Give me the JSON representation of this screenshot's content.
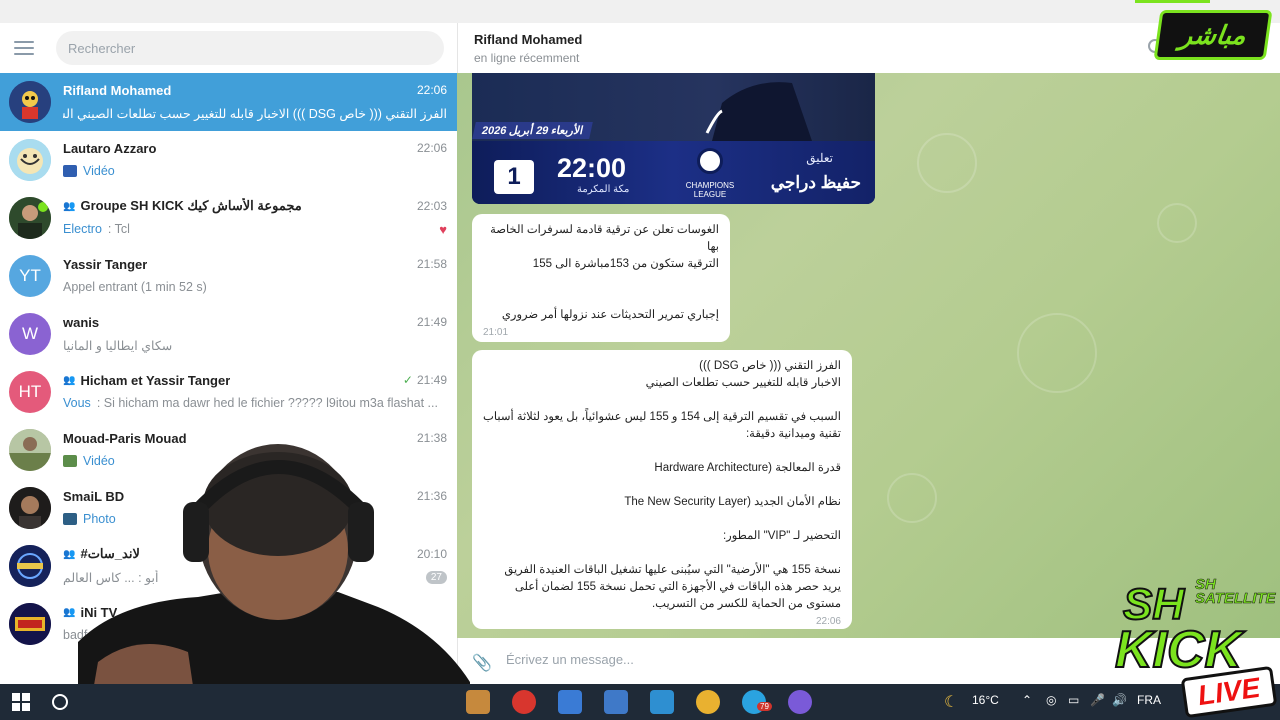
{
  "sidebar": {
    "search_placeholder": "Rechercher",
    "chats": [
      {
        "name": "Rifland Mohamed",
        "time": "22:06",
        "preview": "الفرز التقني ((( خاص DSG ))) الاخبار قابله للتغيير حسب تطلعات الصيني  السبب...",
        "avatar_color": "#2b4f9e",
        "active": true
      },
      {
        "name": "Lautaro Azzaro",
        "time": "22:06",
        "preview": "Vidéo",
        "avatar_color": "#7fc9e6"
      },
      {
        "name": "Groupe SH KICK مجموعة الأساش كيك",
        "time": "22:03",
        "preview_prefix": "Electro",
        "preview": ": Tcl",
        "avatar_color": "#3c6b3a"
      },
      {
        "name": "Yassir Tanger",
        "time": "21:58",
        "preview": "Appel entrant (1 min 52 s)",
        "avatar_text": "YT",
        "avatar_color": "#56a7e0"
      },
      {
        "name": "wanis",
        "time": "21:49",
        "preview": "سكاي ايطاليا و المانيا",
        "avatar_text": "W",
        "avatar_color": "#8a63d2"
      },
      {
        "name": "Hicham et Yassir Tanger",
        "time": "21:49",
        "preview_prefix": "Vous",
        "preview": ": Si hicham ma dawr hed le fichier ????? l9itou m3a flashat ...",
        "avatar_text": "HT",
        "avatar_color": "#e45a7b"
      },
      {
        "name": "Mouad-Paris Mouad",
        "time": "21:38",
        "preview": "Vidéo",
        "avatar_color": "#8a9a6a"
      },
      {
        "name": "SmaiL BD",
        "time": "21:36",
        "preview": "Photo",
        "avatar_color": "#2e2a28"
      },
      {
        "name": "#لاند_سات",
        "time": "20:10",
        "preview": "أبو : ... كاس العالم",
        "badge": "27",
        "avatar_color": "#1a2a6a"
      },
      {
        "name": "iNi TV",
        "time": "",
        "preview": "badf :",
        "avatar_color": "#1a1a5a"
      }
    ]
  },
  "conversation": {
    "name": "Rifland Mohamed",
    "status": "en ligne récemment",
    "card": {
      "date": "الأربعاء 29 أبريل 2026",
      "number": "1",
      "time": "22:00",
      "location": "مكة المكرمة",
      "league": "CHAMPIONS LEAGUE",
      "commentary_label": "تعليق",
      "commentator": "حفيظ دراجي"
    },
    "msg1": {
      "line1": "الغوسات تعلن عن ترقية قادمة لسرفرات الخاصة بها",
      "line2": "الترقية ستكون من 153مباشرة الى 155",
      "line3": "إجباري تمرير التحديثات عند نزولها أمر ضروري",
      "time": "21:01"
    },
    "msg2": {
      "l1": "الفرز التقني ((( خاص DSG )))",
      "l2": "الاخبار قابله للتغيير حسب تطلعات الصيني",
      "l3": "السبب في تقسيم الترقية إلى 154 و 155 ليس عشوائياً، بل يعود لثلاثة أسباب تقنية وميدانية دقيقة:",
      "l4": "قدرة المعالجة (Hardware Architecture",
      "l5": "نظام الأمان الجديد (The New Security Layer",
      "l6": "التحضير لـ \"VIP\" المطور:",
      "l7": "نسخة 155 هي \"الأرضية\" التي سيُبنى عليها تشغيل الباقات العنيدة الفريق يريد حصر هذه الباقات في الأجهزة التي تحمل نسخة 155 لضمان أعلى مستوى من الحماية للكسر من التسريب.",
      "time": "22:06"
    },
    "input_placeholder": "Écrivez un message..."
  },
  "taskbar": {
    "temperature": "16°C",
    "language": "FRA",
    "telegram_badge": "79"
  },
  "overlay": {
    "live_logo": "مباشر",
    "brand_sh": "SH",
    "brand_satellite_1": "SH",
    "brand_satellite_2": "SATELLITE",
    "brand_kick": "KICK",
    "brand_live": "LIVE"
  }
}
